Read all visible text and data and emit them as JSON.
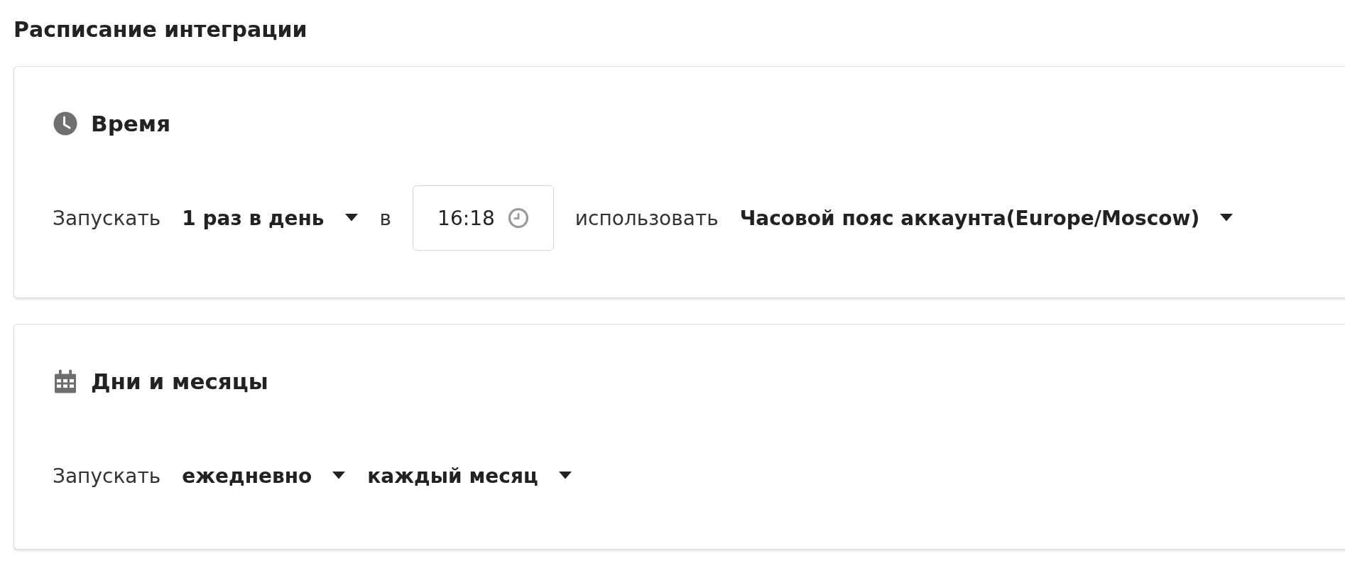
{
  "title": "Расписание интеграции",
  "sections": [
    {
      "kind": "time",
      "heading": "Время",
      "row": [
        {
          "kind": "label",
          "text": "Запускать"
        },
        {
          "kind": "dropdown",
          "value": "1 раз в день"
        },
        {
          "kind": "label",
          "text": "в"
        },
        {
          "kind": "time_input",
          "value": "16:18"
        },
        {
          "kind": "label",
          "text": "использовать"
        },
        {
          "kind": "dropdown",
          "value": "Часовой пояс аккаунта(Europe/Moscow)"
        }
      ]
    },
    {
      "kind": "calendar",
      "heading": "Дни и месяцы",
      "row": [
        {
          "kind": "label",
          "text": "Запускать"
        },
        {
          "kind": "dropdown",
          "value": "ежедневно"
        },
        {
          "kind": "dropdown",
          "value": "каждый месяц"
        }
      ]
    }
  ]
}
